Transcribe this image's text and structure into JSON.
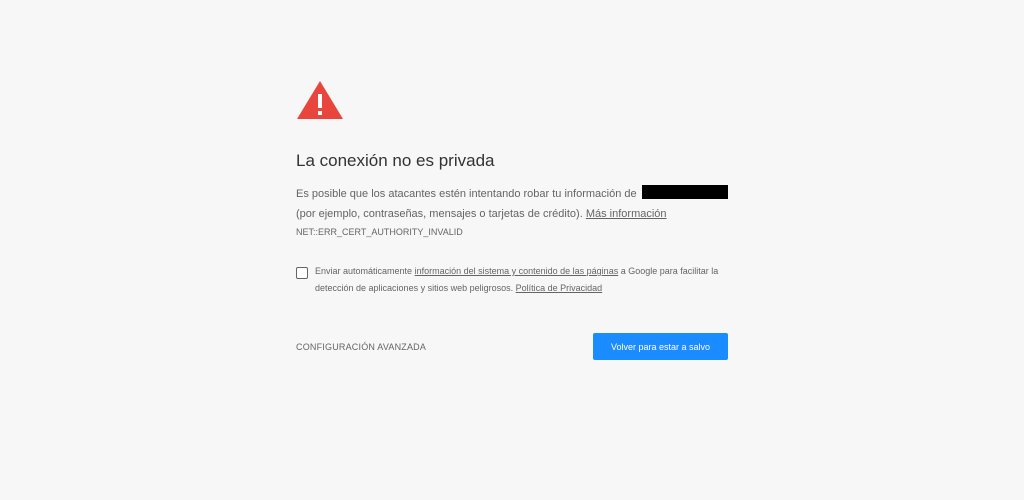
{
  "page": {
    "title": "La conexión no es privada",
    "explanation": {
      "text_before": "Es posible que los atacantes estén intentando robar tu información de",
      "text_after": "(por ejemplo, contraseñas, mensajes o tarjetas de crédito).",
      "learn_more_link": "Más información"
    },
    "error_code": "NET::ERR_CERT_AUTHORITY_INVALID",
    "optin": {
      "text_before": "Enviar automáticamente",
      "system_info_link": "información del sistema y contenido de las páginas",
      "text_middle": "a Google para facilitar la detección de aplicaciones y sitios web peligrosos.",
      "privacy_link": "Política de Privacidad",
      "checked": false
    },
    "actions": {
      "advanced_label": "CONFIGURACIÓN AVANZADA",
      "back_label": "Volver para estar a salvo"
    }
  },
  "colors": {
    "background": "#f7f7f7",
    "warning_red": "#e8453c",
    "primary_blue": "#1a8cff",
    "text": "#646464",
    "title": "#333333"
  },
  "icons": {
    "warning": "warning-triangle-icon"
  }
}
